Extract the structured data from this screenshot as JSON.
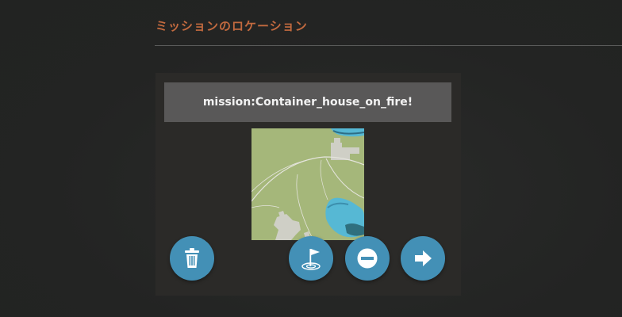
{
  "section": {
    "title": "ミッションのロケーション"
  },
  "mission": {
    "name": "mission:Container_house_on_fire!"
  },
  "actions": {
    "delete_icon": "trash-icon",
    "location_icon": "flag-location-icon",
    "remove_icon": "minus-circle-icon",
    "next_icon": "arrow-right-icon"
  },
  "colors": {
    "title": "#c26a3f",
    "button": "#4390b6",
    "header_bg": "#595858",
    "card_bg": "#2b2a28",
    "page_bg": "#232423",
    "map_land": "#a5b77a",
    "map_water": "#56b8d4"
  }
}
